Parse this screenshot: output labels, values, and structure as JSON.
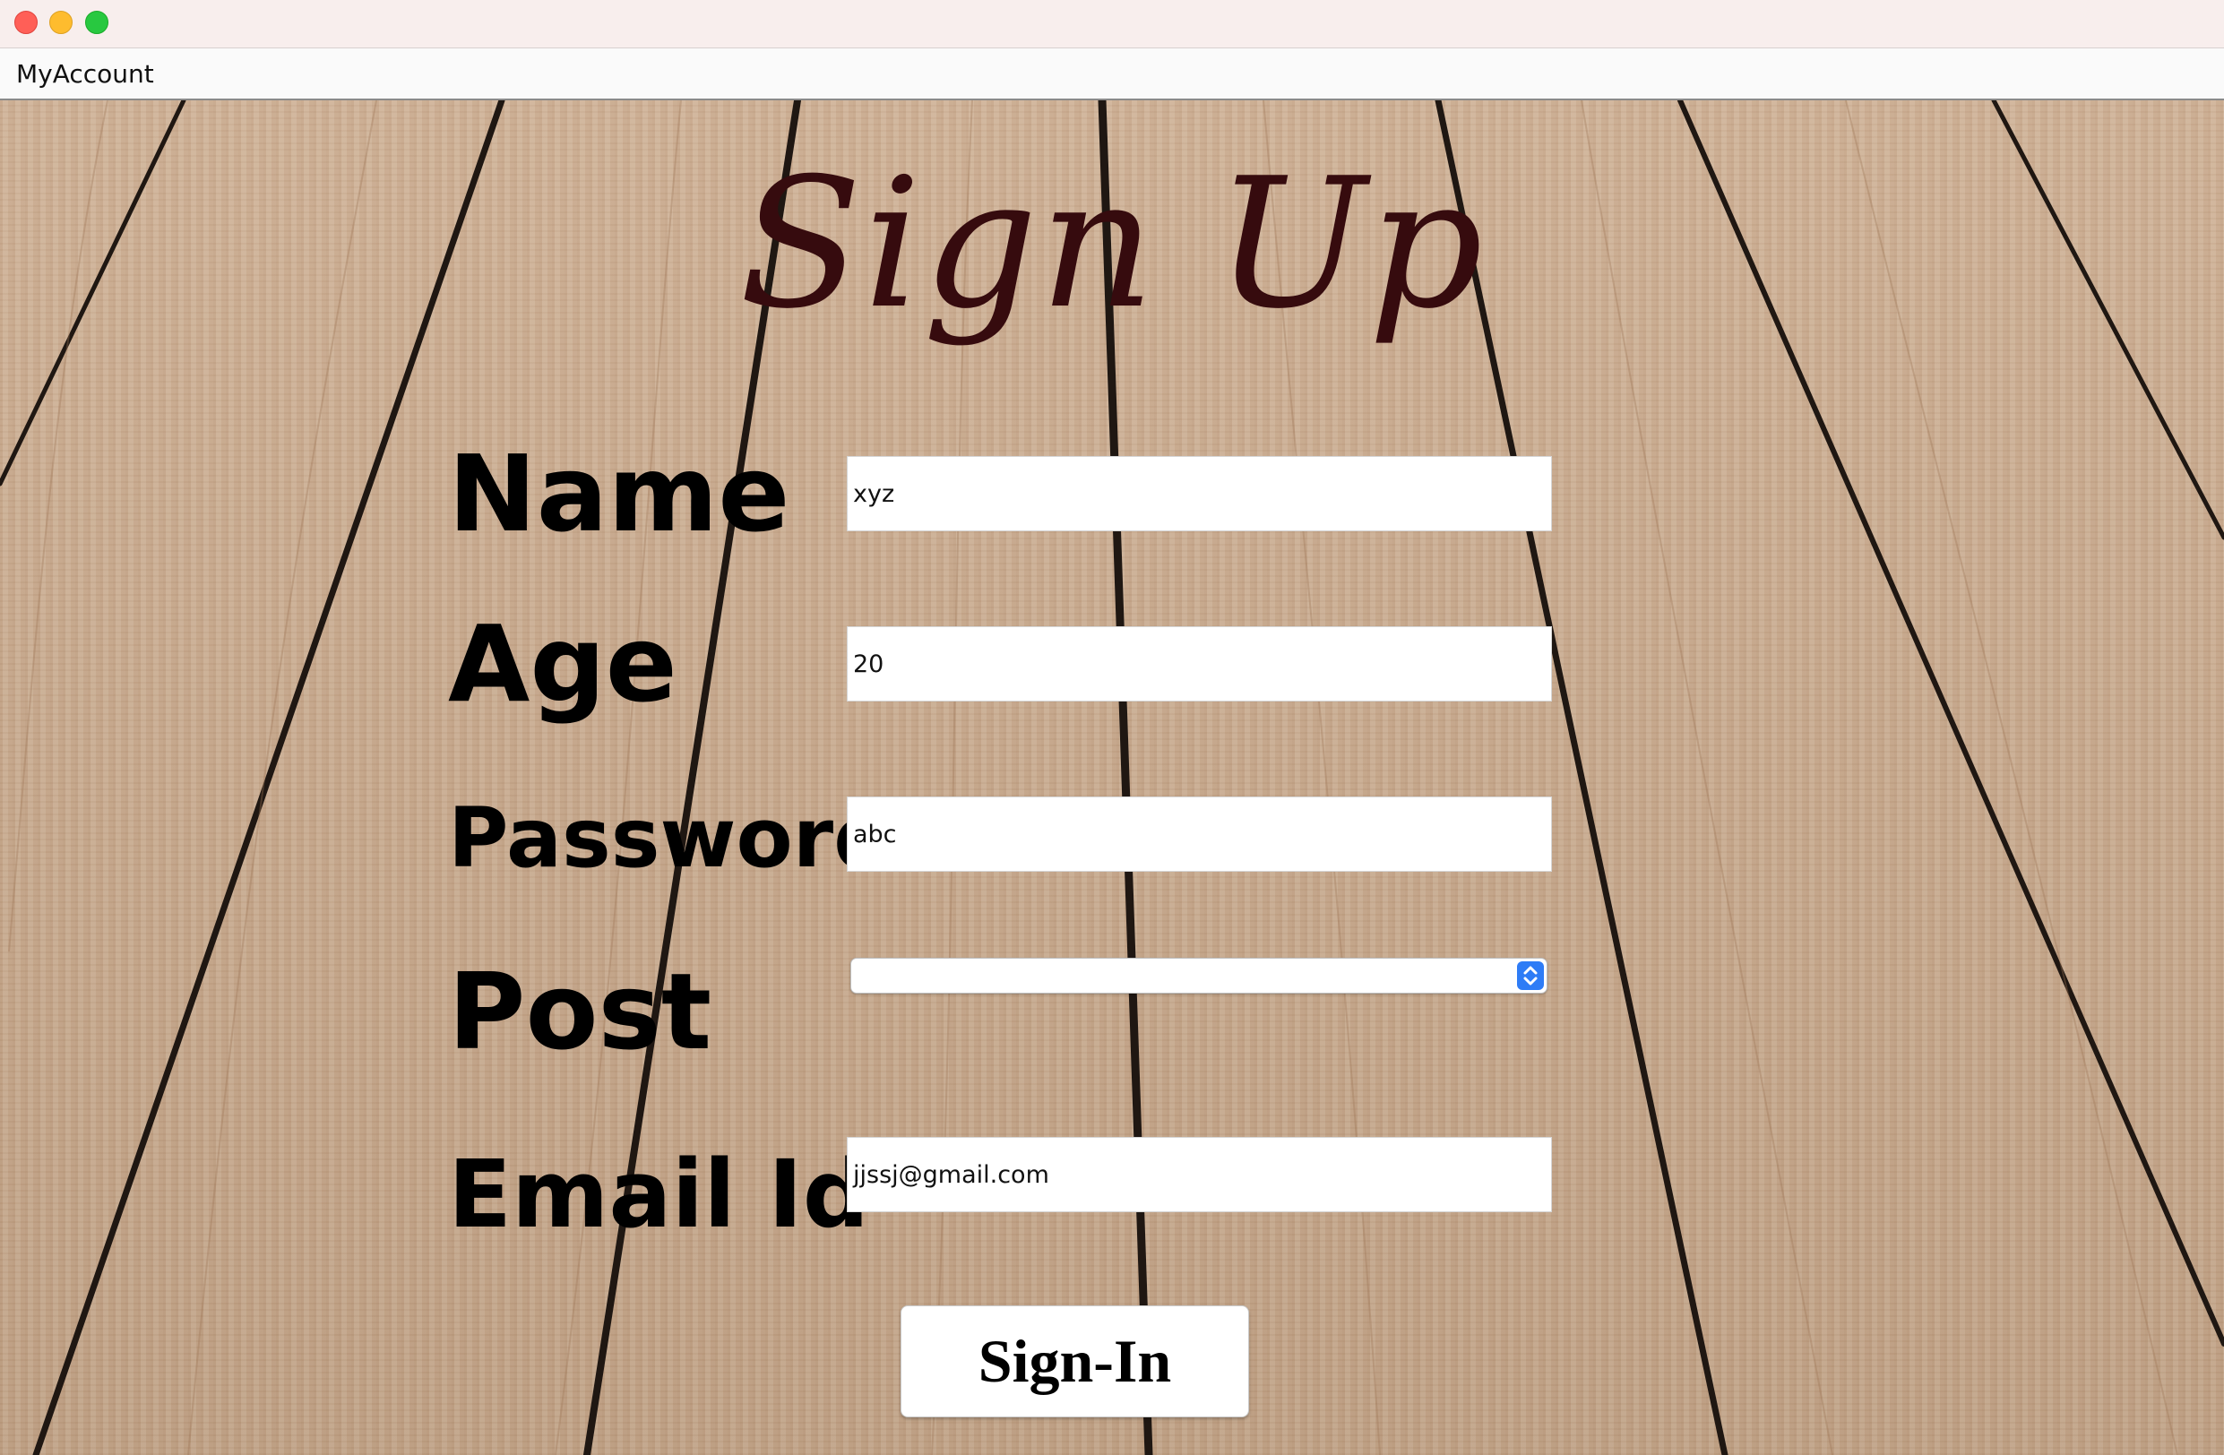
{
  "window": {
    "app_name": "MyAccount"
  },
  "page": {
    "title": "Sign Up"
  },
  "form": {
    "name": {
      "label": "Name",
      "value": "xyz"
    },
    "age": {
      "label": "Age",
      "value": "20"
    },
    "password": {
      "label": "Password",
      "value": "abc"
    },
    "post": {
      "label": "Post",
      "value": ""
    },
    "email": {
      "label": "Email Id",
      "value": "jjssj@gmail.com"
    },
    "submit_label": "Sign-In"
  },
  "colors": {
    "title_text": "#360b0e",
    "accent_blue": "#2e7cf6",
    "window_close": "#ff5f57",
    "window_minimize": "#febc2e",
    "window_zoom": "#28c840"
  },
  "icons": {
    "window_controls": [
      "close-dot",
      "minimize-dot",
      "zoom-dot"
    ],
    "select_stepper": "chevron-updown-icon"
  }
}
